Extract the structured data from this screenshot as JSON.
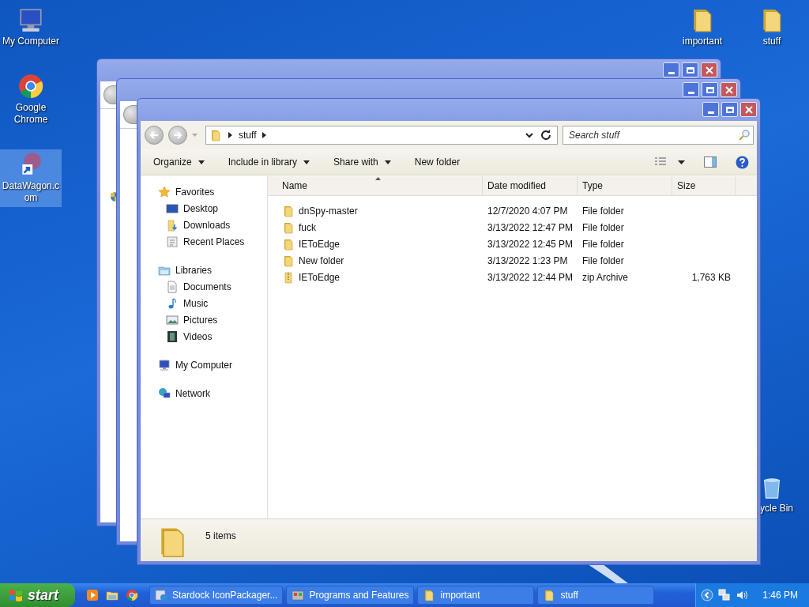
{
  "desktop_icons_left": [
    {
      "label": "My Computer",
      "kind": "computer",
      "selected": false
    },
    {
      "label": "Google Chrome",
      "kind": "chrome",
      "selected": false
    },
    {
      "label": "DataWagon.com",
      "kind": "shortcut",
      "selected": true
    }
  ],
  "desktop_icons_right": [
    {
      "label": "important",
      "kind": "folder",
      "selected": false
    },
    {
      "label": "stuff",
      "kind": "folder",
      "selected": false
    }
  ],
  "recycle_bin": {
    "label": "ycle Bin"
  },
  "window": {
    "path": [
      "stuff"
    ],
    "search": {
      "placeholder": "Search stuff"
    },
    "toolbar": [
      {
        "label": "Organize",
        "dropdown": true
      },
      {
        "label": "Include in library",
        "dropdown": true
      },
      {
        "label": "Share with",
        "dropdown": true
      },
      {
        "label": "New folder",
        "dropdown": false
      }
    ],
    "sidebar": [
      {
        "label": "Favorites",
        "kind": "star",
        "children": [
          {
            "label": "Desktop",
            "kind": "desktop"
          },
          {
            "label": "Downloads",
            "kind": "downloads"
          },
          {
            "label": "Recent Places",
            "kind": "recent"
          }
        ]
      },
      {
        "label": "Libraries",
        "kind": "library",
        "children": [
          {
            "label": "Documents",
            "kind": "documents"
          },
          {
            "label": "Music",
            "kind": "music"
          },
          {
            "label": "Pictures",
            "kind": "pictures"
          },
          {
            "label": "Videos",
            "kind": "videos"
          }
        ]
      },
      {
        "label": "My Computer",
        "kind": "computer"
      },
      {
        "label": "Network",
        "kind": "network"
      }
    ],
    "columns": [
      {
        "label": "Name",
        "sorted": true
      },
      {
        "label": "Date modified",
        "sorted": false
      },
      {
        "label": "Type",
        "sorted": false
      },
      {
        "label": "Size",
        "sorted": false
      }
    ],
    "rows": [
      {
        "name": "dnSpy-master",
        "date": "12/7/2020 4:07 PM",
        "type": "File folder",
        "kind": "folder"
      },
      {
        "name": "fuck",
        "date": "3/13/2022 12:47 PM",
        "type": "File folder",
        "kind": "folder"
      },
      {
        "name": "IEToEdge",
        "date": "3/13/2022 12:45 PM",
        "type": "File folder",
        "kind": "folder"
      },
      {
        "name": "New folder",
        "date": "3/13/2022 1:23 PM",
        "type": "File folder",
        "kind": "folder"
      },
      {
        "name": "IEToEdge",
        "date": "3/13/2022 12:44 PM",
        "type": "zip Archive",
        "size": "1,763 KB",
        "kind": "zip"
      }
    ],
    "status": "5 items"
  },
  "taskbar": {
    "start": "start",
    "quick_launch": [
      {
        "kind": "media"
      },
      {
        "kind": "explorer"
      },
      {
        "kind": "chrome"
      }
    ],
    "tasks": [
      {
        "label": "Stardock IconPackager...",
        "kind": "installer",
        "selected": false
      },
      {
        "label": "Programs and Features",
        "kind": "programs",
        "selected": false
      },
      {
        "label": "important",
        "kind": "folder",
        "selected": false
      },
      {
        "label": "stuff",
        "kind": "folder",
        "selected": false
      }
    ],
    "clock": "1:46 PM"
  }
}
